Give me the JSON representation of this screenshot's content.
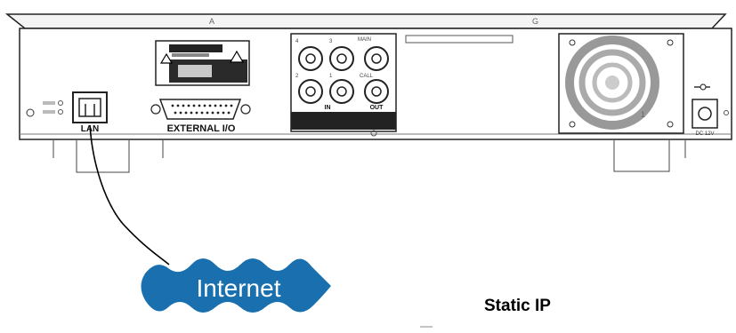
{
  "panel": {
    "lan_label": "LAN",
    "external_io_label": "EXTERNAL I/O",
    "bnc_in_label": "IN",
    "bnc_out_label": "OUT",
    "dc_label": "DC 12V"
  },
  "internet_cloud": {
    "label": "Internet",
    "color": "#1a6fae"
  },
  "static_ip_label": "Static IP",
  "icons": [
    "warning-icon",
    "fan-grille-icon",
    "dc-polarity-icon"
  ]
}
